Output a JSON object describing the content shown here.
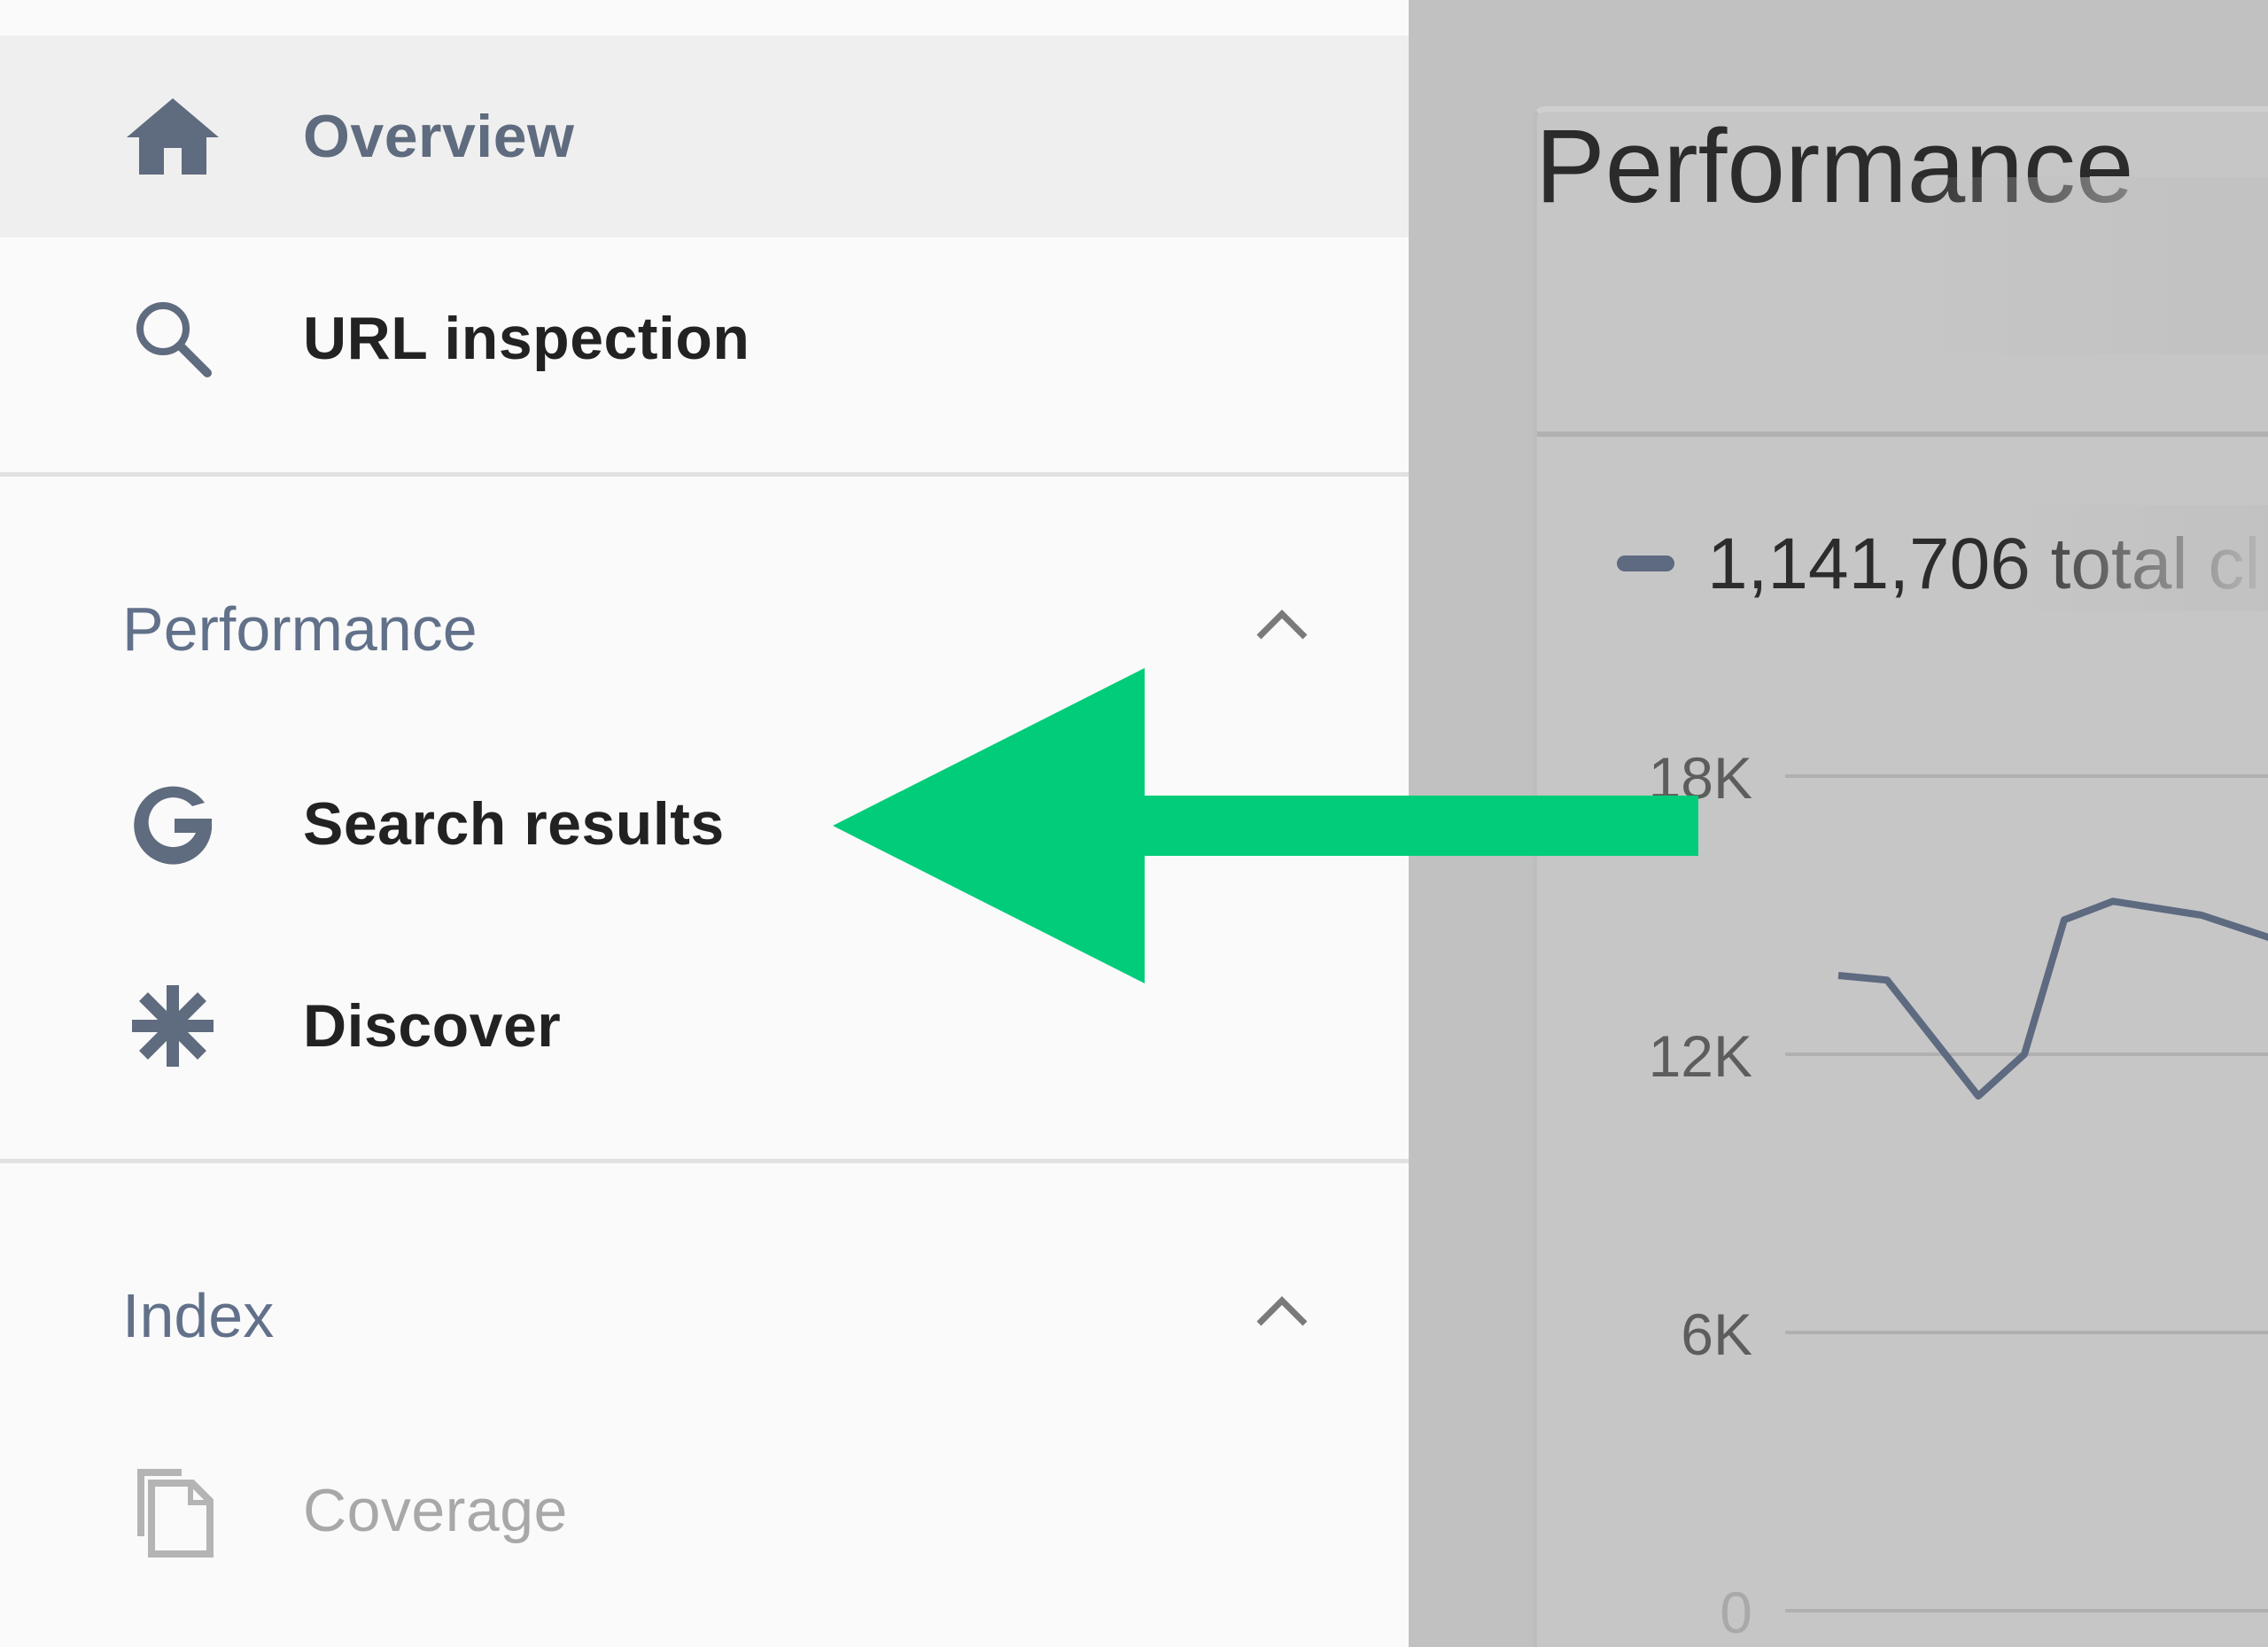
{
  "sidebar": {
    "top_items": [
      {
        "label": "Overview",
        "icon": "home-icon",
        "selected": true
      },
      {
        "label": "URL inspection",
        "icon": "search-icon",
        "selected": false
      }
    ],
    "sections": [
      {
        "title": "Performance",
        "expanded": true,
        "items": [
          {
            "label": "Search results",
            "icon": "google-g-icon"
          },
          {
            "label": "Discover",
            "icon": "asterisk-icon"
          }
        ]
      },
      {
        "title": "Index",
        "expanded": true,
        "items": [
          {
            "label": "Coverage",
            "icon": "copy-pages-icon"
          }
        ]
      }
    ]
  },
  "card": {
    "title": "Performance",
    "legend_text": "1,141,706 total cl",
    "legend_color": "#5d6a80"
  },
  "chart_data": {
    "type": "line",
    "ylim": [
      0,
      18000
    ],
    "yticks": [
      "18K",
      "12K",
      "6K",
      "0"
    ],
    "series": [
      {
        "values": [
          13700,
          13600,
          11100,
          12000,
          14900,
          15300,
          15000,
          14400
        ]
      }
    ]
  },
  "colors": {
    "arrow": "#00cc7a",
    "sidebar_bg": "#fafafa",
    "selected_bg": "#efefef",
    "section_title": "#62718a",
    "overlay": "#c1c1c1"
  }
}
